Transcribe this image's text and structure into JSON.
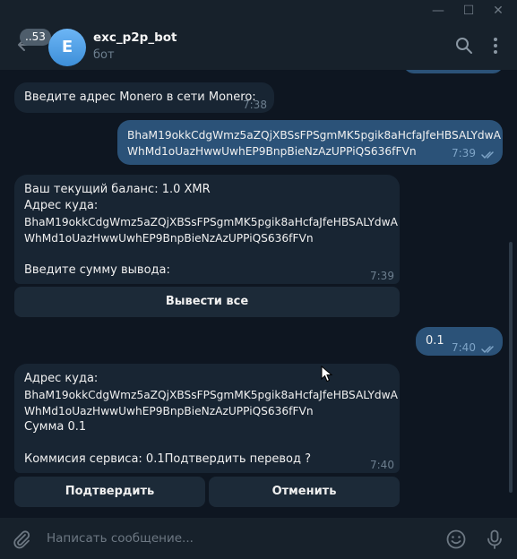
{
  "window": {
    "minimize_glyph": "—",
    "maximize_glyph": "☐",
    "close_glyph": "✕"
  },
  "header": {
    "back_icon": "arrow-left-icon",
    "unread_badge": "..53",
    "avatar_letter": "E",
    "chat_name": "exc_p2p_bot",
    "chat_status": "бот",
    "search_icon": "search-icon",
    "menu_icon": "more-vertical-icon"
  },
  "messages": [
    {
      "direction": "in",
      "lines": [
        "Введите адрес Monero в сети Monero:"
      ],
      "time": "7:38"
    },
    {
      "direction": "out",
      "lines": [
        "BhaM19okkCdgWmz5aZQjXBSsFPSgmMK5pgik8aHcfaJfeHBSALYdwA",
        "WhMd1oUazHwwUwhEP9BnpBieNzAzUPPiQS636fFVn"
      ],
      "time": "7:39",
      "read": true
    },
    {
      "direction": "in",
      "lines": [
        "Ваш текущий баланс: 1.0 XMR",
        "Адрес куда:",
        "BhaM19okkCdgWmz5aZQjXBSsFPSgmMK5pgik8aHcfaJfeHBSALYdwA",
        "WhMd1oUazHwwUwhEP9BnpBieNzAzUPPiQS636fFVn",
        "",
        "Введите сумму вывода:"
      ],
      "time": "7:39",
      "buttons": [
        "Вывести все"
      ]
    },
    {
      "direction": "out",
      "lines": [
        "0.1"
      ],
      "time": "7:40",
      "read": true
    },
    {
      "direction": "in",
      "lines": [
        "Адрес куда:",
        "BhaM19okkCdgWmz5aZQjXBSsFPSgmMK5pgik8aHcfaJfeHBSALYdwA",
        "WhMd1oUazHwwUwhEP9BnpBieNzAzUPPiQS636fFVn",
        "Сумма 0.1",
        "",
        "Коммисия сервиса: 0.1Подтвердить перевод ?"
      ],
      "time": "7:40",
      "buttons": [
        "Подтвердить",
        "Отменить"
      ]
    }
  ],
  "composer": {
    "placeholder": "Написать сообщение...",
    "attach_icon": "paperclip-icon",
    "emoji_icon": "emoji-icon",
    "mic_icon": "microphone-icon"
  },
  "colors": {
    "background": "#0e1621",
    "panel": "#17212b",
    "incoming_bubble": "#182533",
    "outgoing_bubble": "#2b5278",
    "keyboard_button": "#1c2a38",
    "accent": "#5eb5f7"
  }
}
